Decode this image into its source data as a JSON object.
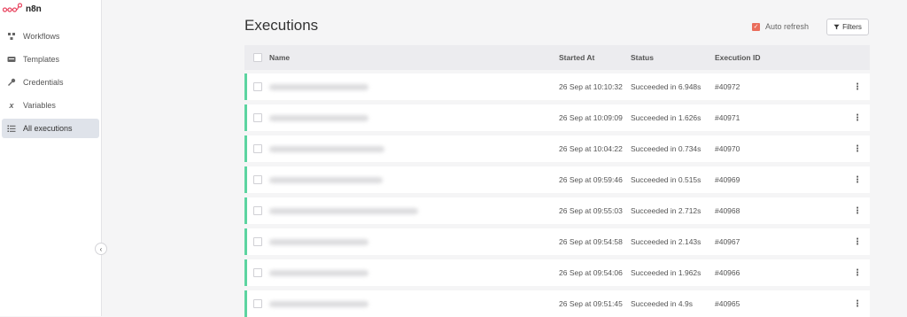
{
  "app": {
    "name": "n8n"
  },
  "sidebar": {
    "items": [
      {
        "label": "Workflows",
        "icon": "workflows-icon"
      },
      {
        "label": "Templates",
        "icon": "templates-icon"
      },
      {
        "label": "Credentials",
        "icon": "key-icon"
      },
      {
        "label": "Variables",
        "icon": "variable-icon"
      },
      {
        "label": "All executions",
        "icon": "list-icon",
        "active": true
      }
    ],
    "collapse_icon": "chevron-left-icon"
  },
  "header": {
    "title": "Executions",
    "auto_refresh_label": "Auto refresh",
    "auto_refresh_checked": true,
    "filters_label": "Filters"
  },
  "table": {
    "columns": [
      "Name",
      "Started At",
      "Status",
      "Execution ID"
    ],
    "rows": [
      {
        "started": "26 Sep at 10:10:32",
        "status": "Succeeded in 6.948s",
        "id": "#40972"
      },
      {
        "started": "26 Sep at 10:09:09",
        "status": "Succeeded in 1.626s",
        "id": "#40971"
      },
      {
        "started": "26 Sep at 10:04:22",
        "status": "Succeeded in 0.734s",
        "id": "#40970"
      },
      {
        "started": "26 Sep at 09:59:46",
        "status": "Succeeded in 0.515s",
        "id": "#40969"
      },
      {
        "started": "26 Sep at 09:55:03",
        "status": "Succeeded in 2.712s",
        "id": "#40968"
      },
      {
        "started": "26 Sep at 09:54:58",
        "status": "Succeeded in 2.143s",
        "id": "#40967"
      },
      {
        "started": "26 Sep at 09:54:06",
        "status": "Succeeded in 1.962s",
        "id": "#40966"
      },
      {
        "started": "26 Sep at 09:51:45",
        "status": "Succeeded in 4.9s",
        "id": "#40965"
      }
    ]
  },
  "colors": {
    "accent": "#ea6d5b",
    "success_bar": "#5cd4a0",
    "active_nav": "#dfe3ea"
  }
}
